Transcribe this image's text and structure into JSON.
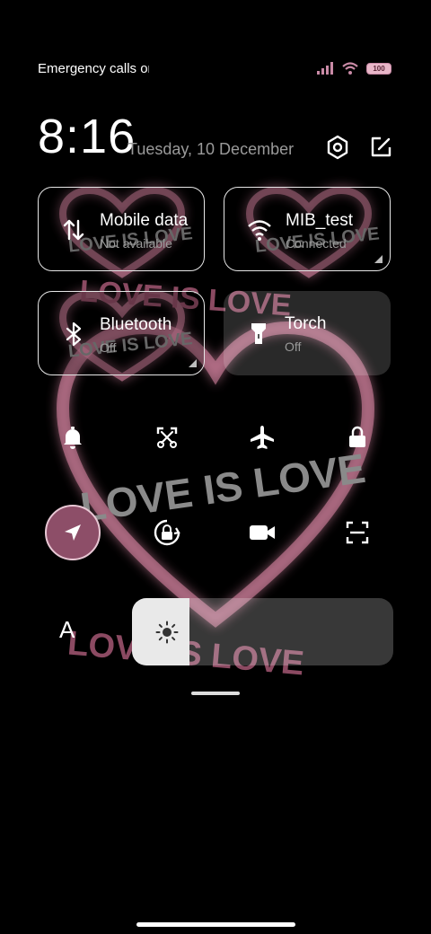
{
  "status_bar": {
    "carrier_text": "Emergency calls only",
    "signal_icon": "signal-icon",
    "wifi_icon": "wifi-icon",
    "battery_level": "100"
  },
  "header": {
    "time": "8:16",
    "date": "Tuesday, 10 December",
    "settings_icon": "gear-icon",
    "edit_icon": "edit-icon"
  },
  "tiles": [
    {
      "name": "Mobile data",
      "status": "Not available",
      "icon": "mobile-data-icon",
      "active": false
    },
    {
      "name": "MIB_test",
      "status": "Connected",
      "icon": "wifi-icon",
      "active": true
    },
    {
      "name": "Bluetooth",
      "status": "Off",
      "icon": "bluetooth-icon",
      "active": true
    },
    {
      "name": "Torch",
      "status": "Off",
      "icon": "torch-icon",
      "active": false
    }
  ],
  "quick_toggles": [
    {
      "icon": "bell-icon",
      "active": false
    },
    {
      "icon": "screenshot-icon",
      "active": false
    },
    {
      "icon": "airplane-icon",
      "active": false
    },
    {
      "icon": "lock-icon",
      "active": false
    },
    {
      "icon": "location-icon",
      "active": true
    },
    {
      "icon": "rotation-lock-icon",
      "active": false
    },
    {
      "icon": "video-camera-icon",
      "active": false
    },
    {
      "icon": "scanner-icon",
      "active": false
    }
  ],
  "brightness": {
    "auto_label": "A",
    "level": 0.22,
    "icon": "sun-icon"
  },
  "wallpaper_text": "LOVE IS LOVE",
  "colors": {
    "accent": "#8d4e68",
    "accent_border": "#e8c7d4",
    "neon_pink": "#e28aa9",
    "tile_outline": "#e7e7e7",
    "secondary_text": "#9a9a9a"
  }
}
